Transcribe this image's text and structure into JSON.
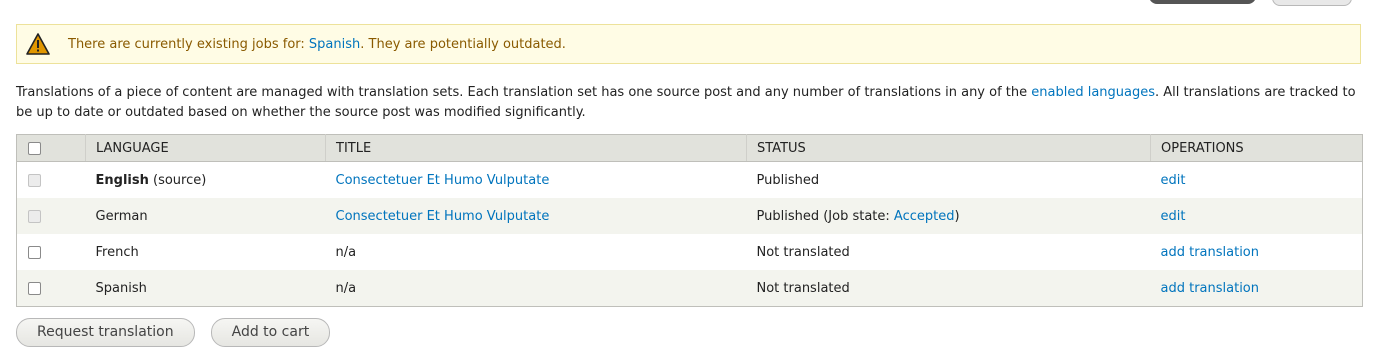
{
  "warning": {
    "prefix": "There are currently existing jobs for: ",
    "language_link": "Spanish",
    "suffix": ". They are potentially outdated."
  },
  "description": {
    "part1": "Translations of a piece of content are managed with translation sets. Each translation set has one source post and any number of translations in any of the ",
    "link": "enabled languages",
    "part2": ". All translations are tracked to be up to date or outdated based on whether the source post was modified significantly."
  },
  "table": {
    "headers": {
      "language": "LANGUAGE",
      "title": "TITLE",
      "status": "STATUS",
      "operations": "OPERATIONS"
    },
    "rows": [
      {
        "language": "English",
        "source_note": " (source)",
        "title": "Consectetuer Et Humo Vulputate",
        "status": "Published",
        "operation": "edit"
      },
      {
        "language": "German",
        "title": "Consectetuer Et Humo Vulputate",
        "status_prefix": "Published (Job state: ",
        "status_link": "Accepted",
        "status_suffix": ")",
        "operation": "edit"
      },
      {
        "language": "French",
        "title": "n/a",
        "status": "Not translated",
        "operation": "add translation"
      },
      {
        "language": "Spanish",
        "title": "n/a",
        "status": "Not translated",
        "operation": "add translation"
      }
    ]
  },
  "actions": {
    "request_translation": "Request translation",
    "add_to_cart": "Add to cart"
  }
}
